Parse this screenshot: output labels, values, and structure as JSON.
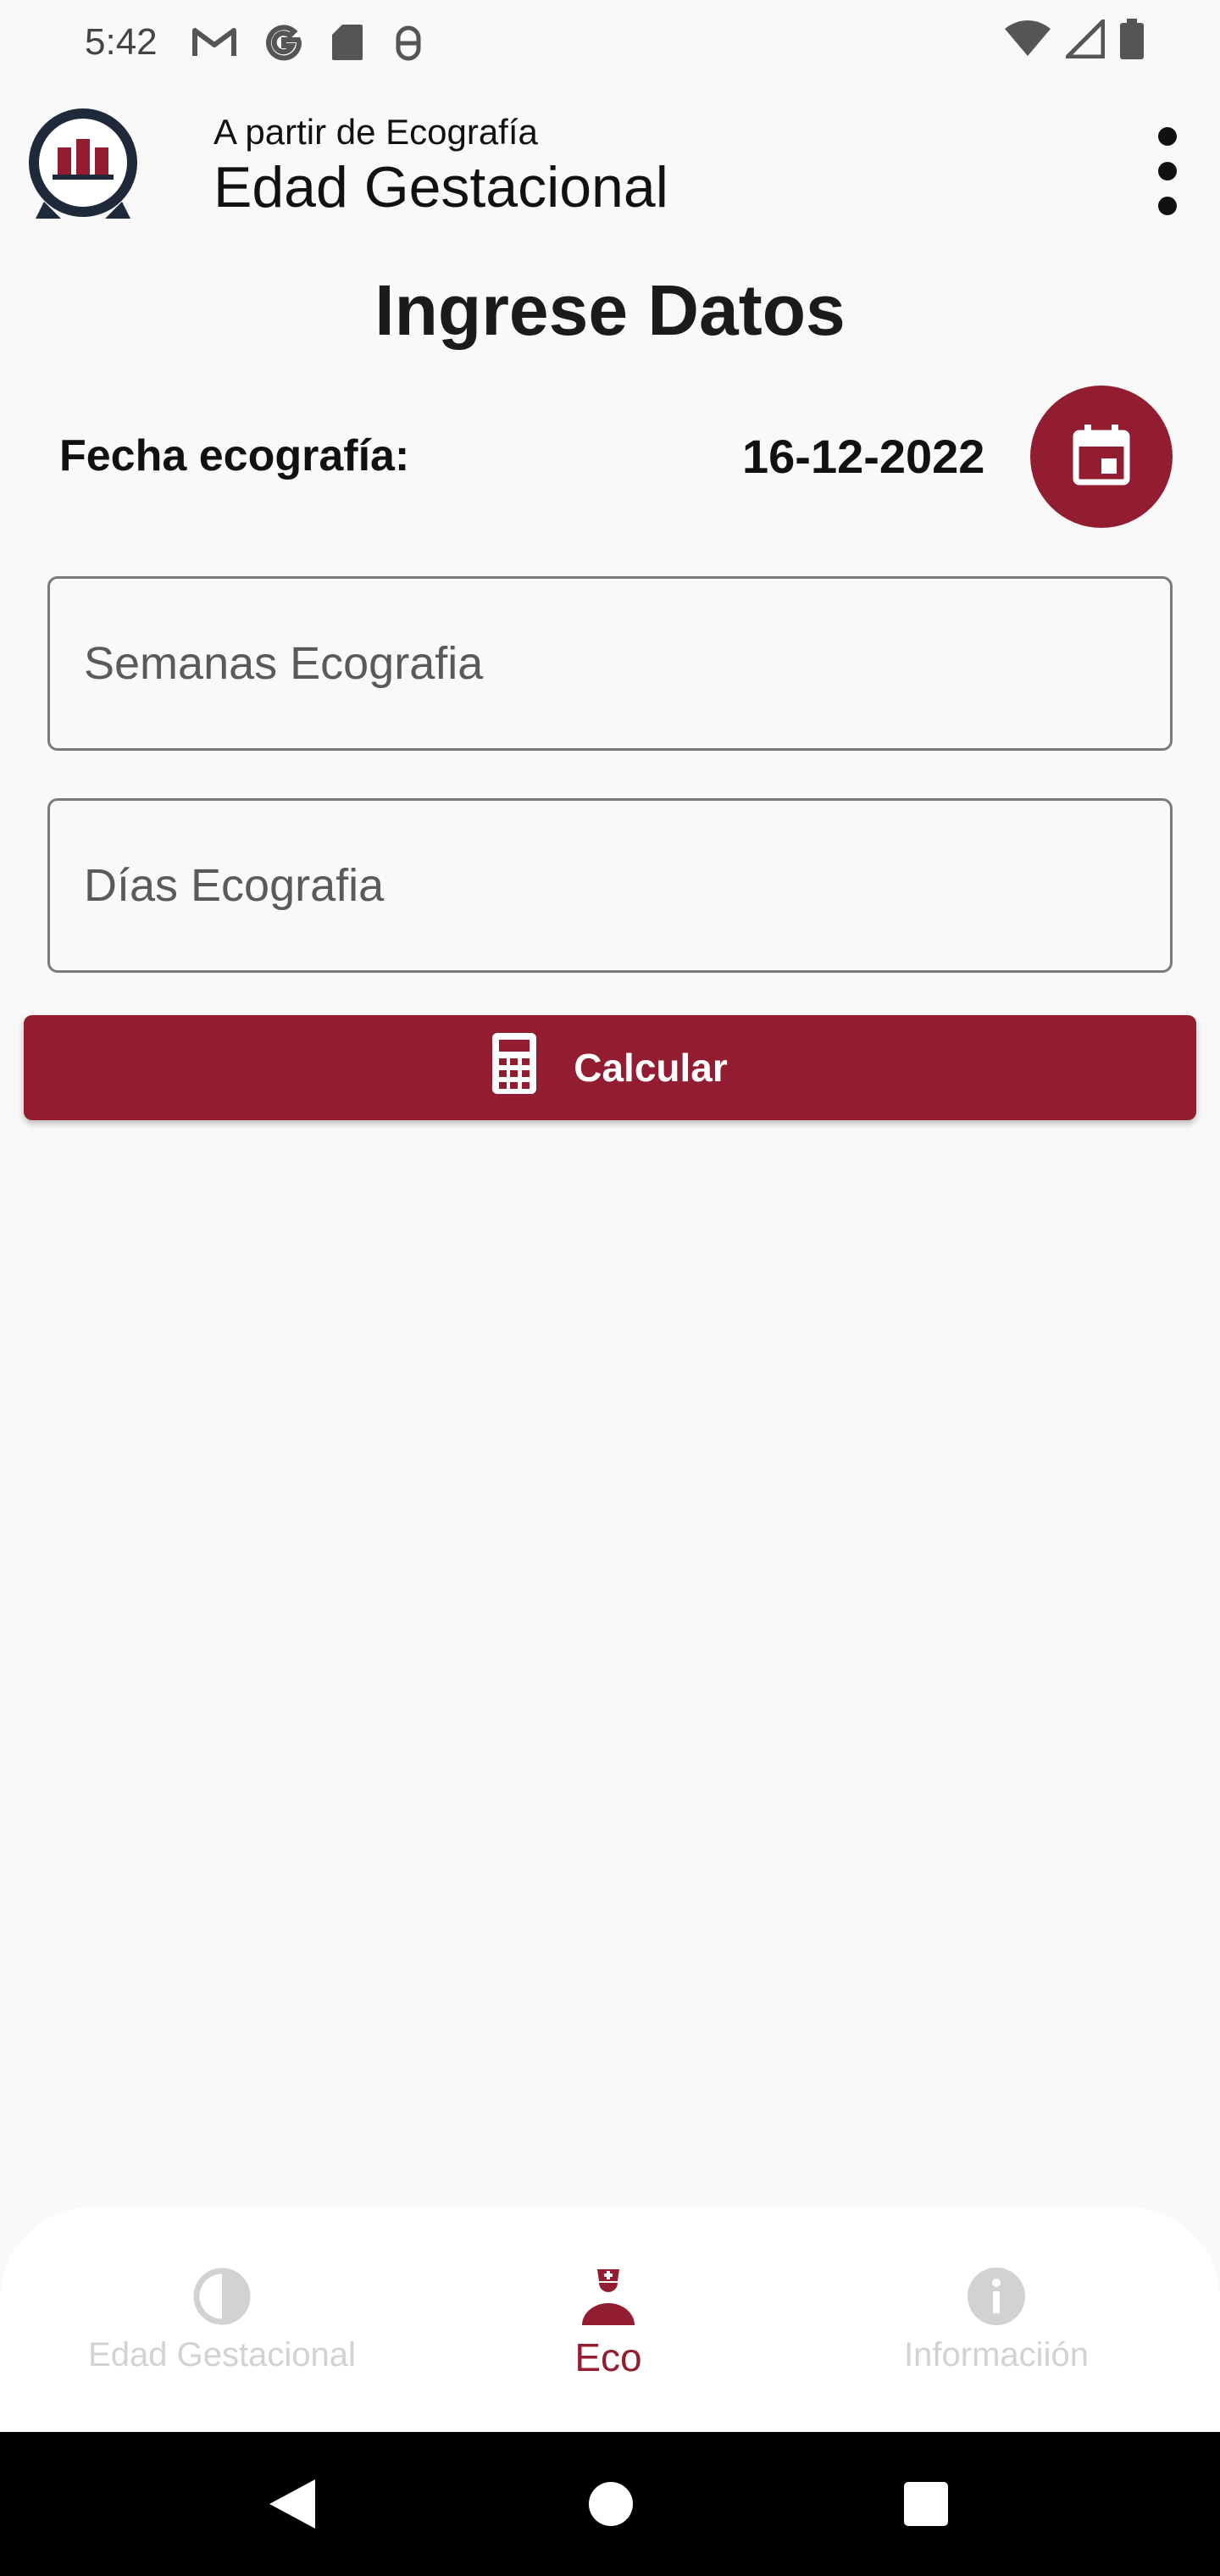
{
  "status_bar": {
    "time": "5:42",
    "left_icons": [
      "gmail-icon",
      "google-icon",
      "sd-card-icon",
      "android-debug-icon"
    ],
    "right_icons": [
      "wifi-icon",
      "signal-icon",
      "battery-icon"
    ]
  },
  "app_bar": {
    "subtitle": "A partir de Ecografía",
    "title": "Edad Gestacional",
    "logo": "app-logo",
    "menu_icon": "more-vert-icon"
  },
  "main": {
    "heading": "Ingrese Datos",
    "date_label": "Fecha ecografía:",
    "date_value": "16-12-2022",
    "calendar_icon": "calendar-icon",
    "weeks_placeholder": "Semanas Ecografia",
    "weeks_value": "",
    "days_placeholder": "Días Ecografia",
    "days_value": "",
    "calculate_label": "Calcular",
    "calculate_icon": "calculator-icon"
  },
  "bottom_nav": {
    "items": [
      {
        "label": "Edad Gestacional",
        "icon": "contrast-icon",
        "active": false
      },
      {
        "label": "Eco",
        "icon": "nurse-icon",
        "active": true
      },
      {
        "label": "Informaciión",
        "icon": "info-icon",
        "active": false
      }
    ]
  },
  "colors": {
    "accent": "#931d30",
    "background": "#faf9f9",
    "inactive_nav": "#d2d2d2"
  }
}
